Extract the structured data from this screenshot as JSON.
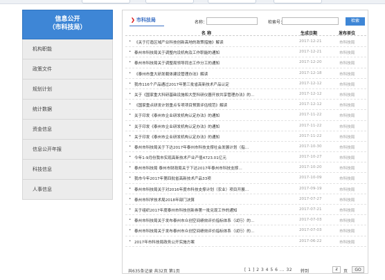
{
  "sidebar": {
    "title_line1": "信息公开",
    "title_line2": "（市科技局）",
    "items": [
      {
        "label": "机构职能"
      },
      {
        "label": "政策文件"
      },
      {
        "label": "规划计划"
      },
      {
        "label": "统计数据"
      },
      {
        "label": "资金信息"
      },
      {
        "label": "信息公开年报"
      },
      {
        "label": "科技信息"
      },
      {
        "label": "人事信息"
      }
    ]
  },
  "header": {
    "breadcrumb": "市科技局",
    "name_label": "名称：",
    "name_value": "",
    "index_label": "检索号：",
    "index_value": "",
    "search_button": "检索"
  },
  "table": {
    "columns": [
      "名 称",
      "生成日期",
      "发布单位"
    ],
    "rows": [
      {
        "title": "《关于打造区域产业科技创新高地的政策措施》解读",
        "date": "2017-12-21",
        "unit": "市科技局"
      },
      {
        "title": "泰州市科技局关于调整内设机构及工作职能的通知",
        "date": "2017-12-21",
        "unit": "市科技局"
      },
      {
        "title": "泰州市科技局关于调整局领导同志工作分工的通知",
        "date": "2017-12-20",
        "unit": "市科技局"
      },
      {
        "title": "《泰州市重大研发载体建设管理办法》解读",
        "date": "2017-12-18",
        "unit": "市科技局"
      },
      {
        "title": "我市116个产品通过2017年第三批省高新技术产品认定",
        "date": "2017-12-12",
        "unit": "市科技局"
      },
      {
        "title": "关于《国家重大科研基础设施和大型科研仪器开放共享管理办法》的…",
        "date": "2017-12-12",
        "unit": "市科技局"
      },
      {
        "title": "《国家重点研发计划重点专项项目预算评估规范》解读",
        "date": "2017-12-12",
        "unit": "市科技局"
      },
      {
        "title": "关于印发《泰州市企业研发机构认定办法》的通知",
        "date": "2017-11-22",
        "unit": "市科技局"
      },
      {
        "title": "关于印发《泰州市企业研发机构认定办法》的通知",
        "date": "2017-11-22",
        "unit": "市科技局"
      },
      {
        "title": "关于印发《泰州市企业研发机构认定办法》的通知",
        "date": "2017-11-22",
        "unit": "市科技局"
      },
      {
        "title": "泰州市科技局关于下达2017年泰州市科技支撑社会发展计划（指…",
        "date": "2017-10-30",
        "unit": "市科技局"
      },
      {
        "title": "今年1-9月份我市实现高新技术产业产值4723.01亿元",
        "date": "2017-10-27",
        "unit": "市科技局"
      },
      {
        "title": "泰州市科技局 泰州市财政局关于下达2017年泰州市科技支撑…",
        "date": "2017-10-20",
        "unit": "市科技局"
      },
      {
        "title": "我市今年2017年第四批省高新技术产品33项",
        "date": "2017-10-09",
        "unit": "市科技局"
      },
      {
        "title": "泰州市科技局关于对2016年度市科技支撑计划（农业）项目开展…",
        "date": "2017-09-19",
        "unit": "市科技局"
      },
      {
        "title": "泰州市科学技术局2018年部门决算",
        "date": "2017-07-27",
        "unit": "市科技局"
      },
      {
        "title": "关于组织2017年度泰州市科技创新券第一批兑现工作的通知",
        "date": "2017-07-21",
        "unit": "市科技局"
      },
      {
        "title": "泰州市科技局关于发布泰州市众创空间绩效评价指标体系（试行）的…",
        "date": "2017-07-03",
        "unit": "市科技局"
      },
      {
        "title": "泰州市科技局关于发布泰州市众创空间绩效评价指标体系（试行）的…",
        "date": "2017-07-03",
        "unit": "市科技局"
      },
      {
        "title": "2017年市科技局政务公开实施方案",
        "date": "2017-06-22",
        "unit": "市科技局"
      }
    ]
  },
  "pagination": {
    "stats": "共635条记录   共32页   第1页",
    "pages": "[ 1 ] 2  3  4  5  6 ...   32",
    "goto_label": "转到",
    "goto_value": "2",
    "page_suffix": "页",
    "go_button": "GO"
  },
  "colors": {
    "accent": "#3e86d6",
    "breadcrumb_arrow": "#dd2222",
    "muted_text": "#999999"
  }
}
